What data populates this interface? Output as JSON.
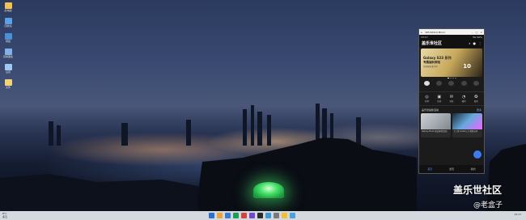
{
  "desktop": {
    "icons": [
      {
        "label": "此电脑",
        "color": "#f2c14e"
      },
      {
        "label": "回收站",
        "color": "#5aa0e6"
      },
      {
        "label": "网络",
        "color": "#4a90d9"
      },
      {
        "label": "控制面板",
        "color": "#7fb3e6"
      },
      {
        "label": "设置",
        "color": "#9ec9f5"
      },
      {
        "label": "文件",
        "color": "#f1d27a"
      }
    ]
  },
  "phone": {
    "window_title": "SM-S9310 Mirror",
    "status": {
      "time": "13:17",
      "right": "5G 90%"
    },
    "app": {
      "title": "盖乐世社区",
      "icons": {
        "search": "search-icon",
        "bell": "bell-icon",
        "menu": "more-icon"
      }
    },
    "banner": {
      "line1": "Galaxy S23 系列",
      "line2": "专属福利来啦",
      "line3": "活动报名进行中",
      "number": "10"
    },
    "shortcuts": [
      "",
      "",
      "",
      "",
      ""
    ],
    "grid": [
      {
        "icon": "◎",
        "label": "签到"
      },
      {
        "icon": "▣",
        "label": "活动"
      },
      {
        "icon": "✉",
        "label": "消息"
      },
      {
        "icon": "◔",
        "label": "福利"
      },
      {
        "icon": "✪",
        "label": "服务"
      }
    ],
    "section": {
      "title": "盖乐世最新活动",
      "more": "更多"
    },
    "cards": [
      {
        "caption": "Galaxy Buds 新品体验活动"
      },
      {
        "caption": "【三星 Galaxy 】壁纸分享"
      }
    ],
    "tabs": [
      {
        "label": "首页",
        "active": true
      },
      {
        "label": "发现",
        "active": false
      },
      {
        "label": "我的",
        "active": false
      }
    ]
  },
  "taskbar": {
    "weather": {
      "temp": "8°C",
      "desc": "多云"
    },
    "icons": [
      "#2b6fd6",
      "#e8a33a",
      "#3a7bd5",
      "#1f9d55",
      "#d6453a",
      "#6c4ad6",
      "#2b2b2b",
      "#3a9ad6",
      "#7a7a7a",
      "#f0c030",
      "#4aa3df"
    ],
    "tray": "13:17"
  },
  "watermark": {
    "line1": "盖乐世社区",
    "line2": "@老盒子"
  }
}
